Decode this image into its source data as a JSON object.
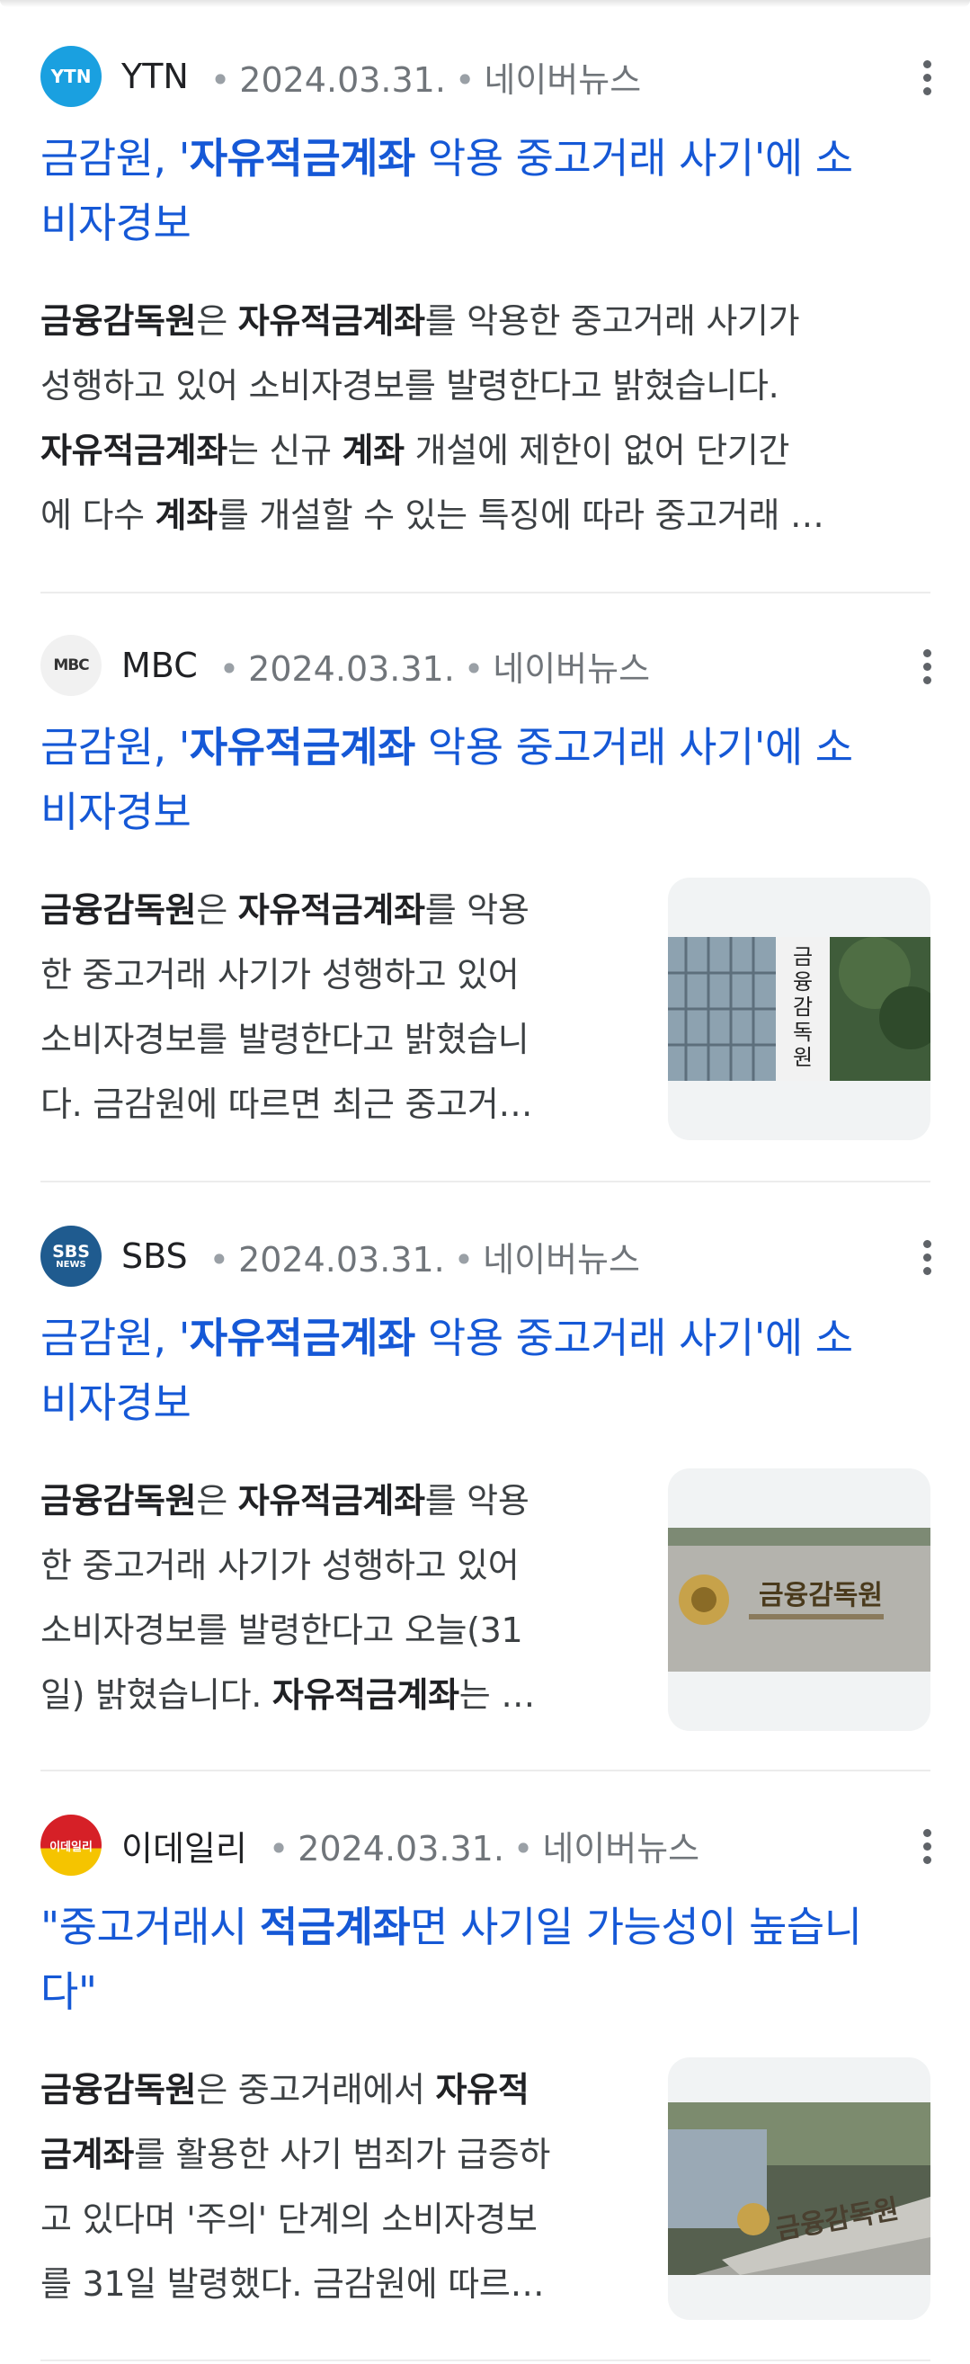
{
  "results": [
    {
      "source": "YTN",
      "date": "2024.03.31.",
      "provider": "네이버뉴스",
      "title_pre": "금감원, '",
      "title_bold": "자유적금계좌",
      "title_post": " 악용 중고거래 사기'에 소",
      "title_line2": "비자경보",
      "snippet": [
        [
          {
            "b": "금융감독원"
          },
          {
            "t": "은 "
          },
          {
            "b": "자유적금계좌"
          },
          {
            "t": "를 악용한 중고거래 사기가"
          }
        ],
        [
          {
            "t": "성행하고 있어 소비자경보를 발령한다고 밝혔습니다."
          }
        ],
        [
          {
            "b": "자유적금계좌"
          },
          {
            "t": "는 신규 "
          },
          {
            "b": "계좌"
          },
          {
            "t": " 개설에 제한이 없어 단기간"
          }
        ],
        [
          {
            "t": "에 다수 "
          },
          {
            "b": "계좌"
          },
          {
            "t": "를 개설할 수 있는 특징에 따라 중고거래 …"
          }
        ]
      ]
    },
    {
      "source": "MBC",
      "date": "2024.03.31.",
      "provider": "네이버뉴스",
      "title_pre": "금감원, '",
      "title_bold": "자유적금계좌",
      "title_post": " 악용 중고거래 사기'에 소",
      "title_line2": "비자경보",
      "snippet": [
        [
          {
            "b": "금융감독원"
          },
          {
            "t": "은 "
          },
          {
            "b": "자유적금계좌"
          },
          {
            "t": "를 악용"
          }
        ],
        [
          {
            "t": "한 중고거래 사기가 성행하고 있어"
          }
        ],
        [
          {
            "t": "소비자경보를 발령한다고 밝혔습니"
          }
        ],
        [
          {
            "t": "다. 금감원에 따르면 최근 중고거…"
          }
        ]
      ],
      "thumb_text": "금융감독원"
    },
    {
      "source": "SBS",
      "date": "2024.03.31.",
      "provider": "네이버뉴스",
      "title_pre": "금감원, '",
      "title_bold": "자유적금계좌",
      "title_post": " 악용 중고거래 사기'에 소",
      "title_line2": "비자경보",
      "snippet": [
        [
          {
            "b": "금융감독원"
          },
          {
            "t": "은 "
          },
          {
            "b": "자유적금계좌"
          },
          {
            "t": "를 악용"
          }
        ],
        [
          {
            "t": "한 중고거래 사기가 성행하고 있어"
          }
        ],
        [
          {
            "t": "소비자경보를 발령한다고 오늘(31"
          }
        ],
        [
          {
            "t": "일) 밝혔습니다. "
          },
          {
            "b": "자유적금계좌"
          },
          {
            "t": "는 …"
          }
        ]
      ],
      "thumb_text": "금융감독원"
    },
    {
      "source": "이데일리",
      "date": "2024.03.31.",
      "provider": "네이버뉴스",
      "title_pre": "\"중고거래시 ",
      "title_bold": "적금계좌",
      "title_post": "면 사기일 가능성이 높습니",
      "title_line2": "다\"",
      "snippet": [
        [
          {
            "b": "금융감독원"
          },
          {
            "t": "은 중고거래에서 "
          },
          {
            "b": "자유적"
          }
        ],
        [
          {
            "b": "금계좌"
          },
          {
            "t": "를 활용한 사기 범죄가 급증하"
          }
        ],
        [
          {
            "t": "고 있다며 '주의' 단계의 소비자경보"
          }
        ],
        [
          {
            "t": "를 31일 발령했다. 금감원에 따르…"
          }
        ]
      ],
      "thumb_text": "금융감독원"
    }
  ],
  "logos": {
    "ytn": "YTN",
    "mbc": "MBC",
    "sbs": "SBS",
    "sbs_sub": "NEWS",
    "edaily": "이데일리"
  },
  "colors": {
    "title": "#1558d6",
    "ytn": "#1aa0e0",
    "sbs": "#1f5b8f",
    "edaily_top": "#d62027",
    "edaily_bottom": "#f5c400"
  }
}
